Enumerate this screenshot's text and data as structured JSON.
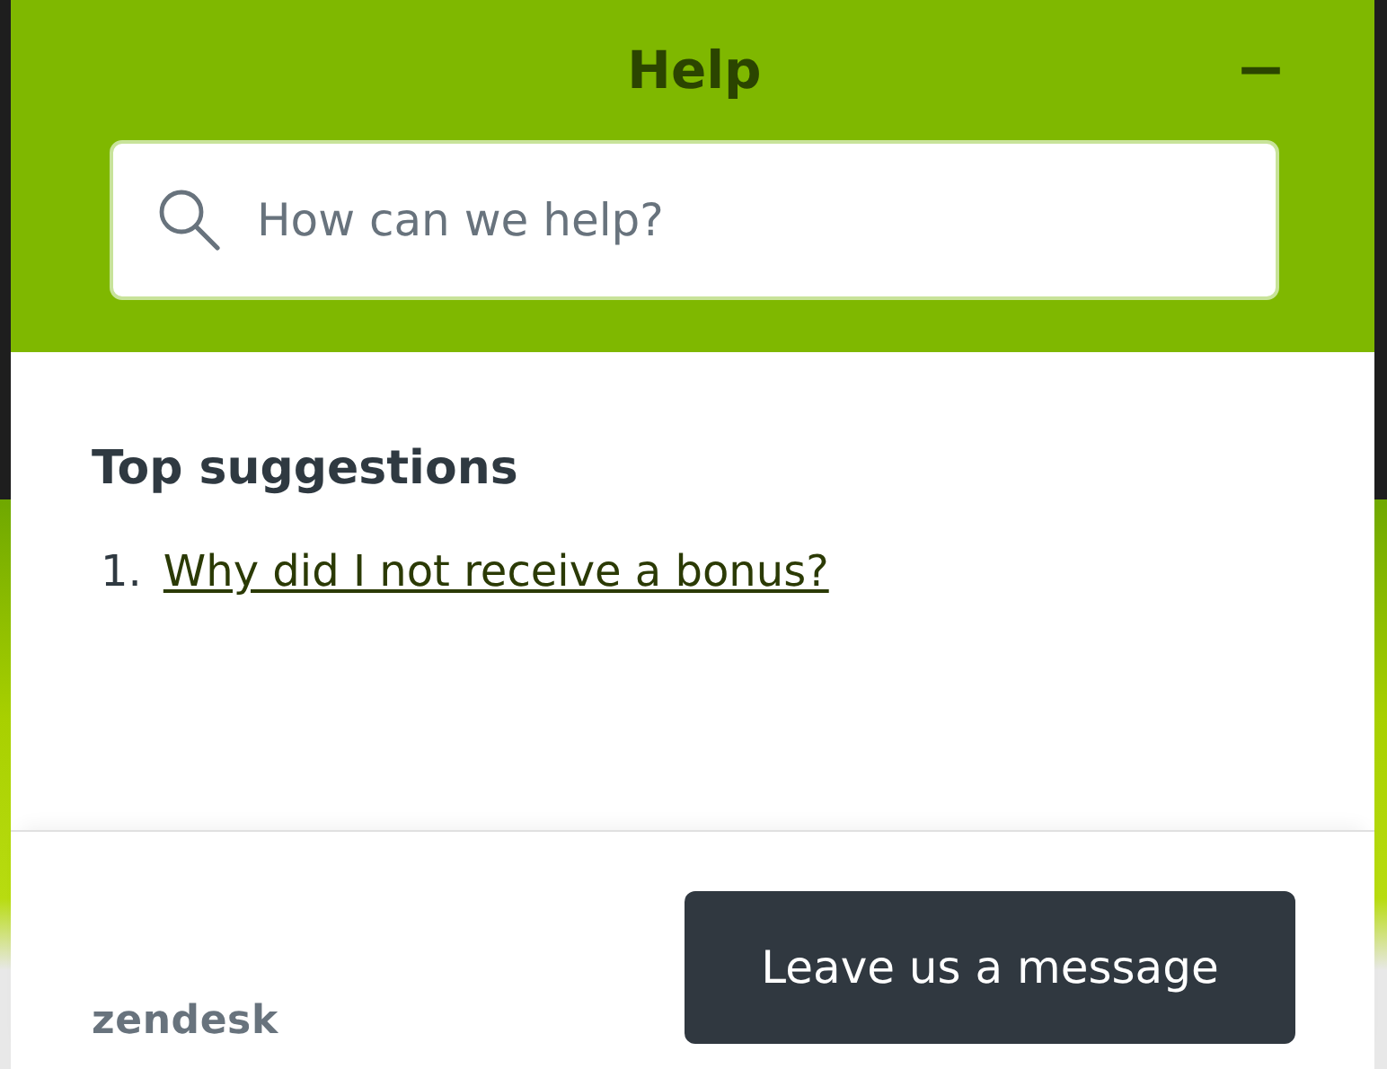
{
  "header": {
    "title": "Help",
    "minimize_label": "−"
  },
  "search": {
    "placeholder": "How can we help?"
  },
  "suggestions": {
    "heading": "Top suggestions",
    "items": [
      {
        "number": "1.",
        "text": "Why did I not receive a bonus?"
      }
    ]
  },
  "footer": {
    "logo": "zendesk",
    "button": "Leave us a message"
  }
}
